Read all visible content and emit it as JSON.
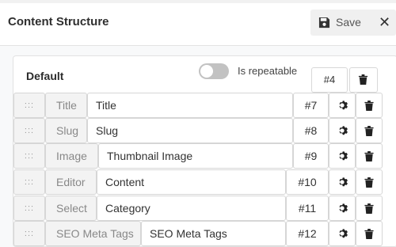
{
  "header": {
    "title": "Content Structure",
    "save_label": "Save",
    "close_glyph": "✕"
  },
  "group": {
    "title": "Default",
    "toggle_label": "Is repeatable",
    "position": "#4"
  },
  "fields": [
    {
      "type": "Title",
      "name": "Title",
      "position": "#7"
    },
    {
      "type": "Slug",
      "name": "Slug",
      "position": "#8"
    },
    {
      "type": "Image",
      "name": "Thumbnail Image",
      "position": "#9"
    },
    {
      "type": "Editor",
      "name": "Content",
      "position": "#10"
    },
    {
      "type": "Select",
      "name": "Category",
      "position": "#11"
    },
    {
      "type": "SEO Meta Tags",
      "name": "SEO Meta Tags",
      "position": "#12"
    }
  ],
  "icons": {
    "save": "floppy-disk-icon",
    "close": "close-icon",
    "drag": "drag-handle-icon",
    "settings": "gear-icon",
    "delete": "trash-icon"
  }
}
